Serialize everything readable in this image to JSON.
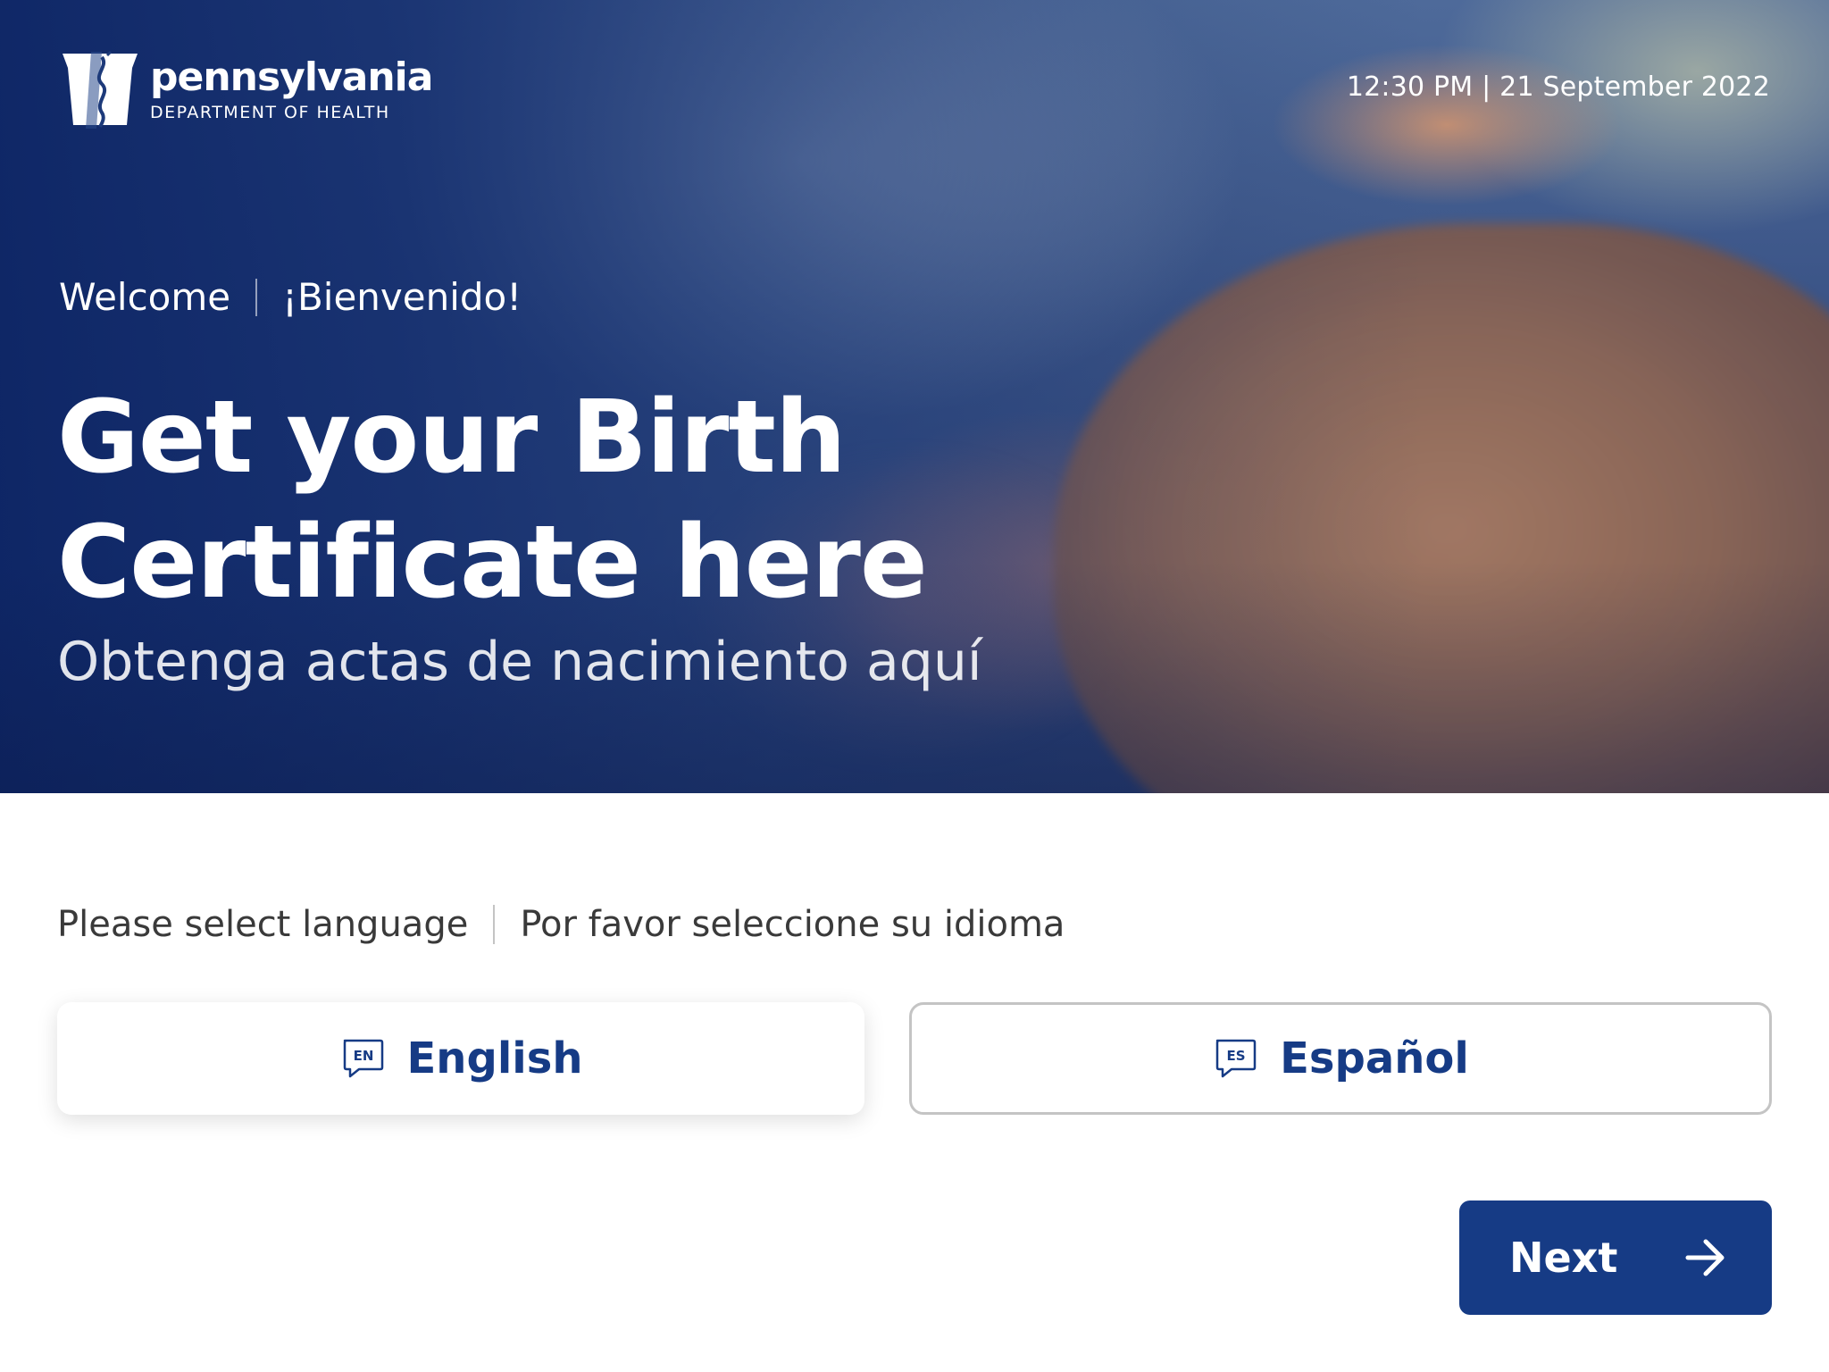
{
  "header": {
    "logo": {
      "name": "pennsylvania",
      "subtitle": "DEPARTMENT OF HEALTH",
      "icon": "keystone-logo-icon"
    },
    "datetime": "12:30 PM | 21 September 2022"
  },
  "hero": {
    "welcome_en": "Welcome",
    "welcome_es": "¡Bienvenido!",
    "headline": "Get your Birth Certificate here",
    "subheadline": "Obtenga actas de nacimiento aquí"
  },
  "language": {
    "prompt_en": "Please select language",
    "prompt_es": "Por favor seleccione su idioma",
    "options": [
      {
        "code": "EN",
        "label": "English",
        "selected": true,
        "icon": "speech-bubble-icon"
      },
      {
        "code": "ES",
        "label": "Español",
        "selected": false,
        "icon": "speech-bubble-icon"
      }
    ]
  },
  "actions": {
    "next_label": "Next",
    "next_icon": "arrow-right-icon"
  },
  "colors": {
    "brand_blue": "#163b85",
    "hero_blue": "#0d2565",
    "border_gray": "#c4c4c4",
    "text_dark": "#3a3a3a"
  }
}
